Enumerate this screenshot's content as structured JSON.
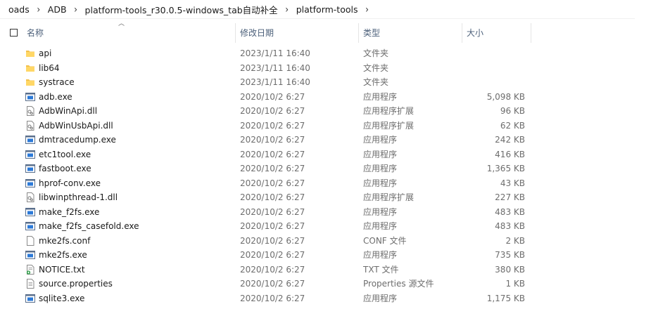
{
  "breadcrumb": [
    "oads",
    "ADB",
    "platform-tools_r30.0.5-windows_tab自动补全",
    "platform-tools"
  ],
  "columns": {
    "name": "名称",
    "date": "修改日期",
    "type": "类型",
    "size": "大小"
  },
  "files": [
    {
      "name": "api",
      "date": "2023/1/11 16:40",
      "type": "文件夹",
      "size": "",
      "icon": "folder-icon"
    },
    {
      "name": "lib64",
      "date": "2023/1/11 16:40",
      "type": "文件夹",
      "size": "",
      "icon": "folder-icon"
    },
    {
      "name": "systrace",
      "date": "2023/1/11 16:40",
      "type": "文件夹",
      "size": "",
      "icon": "folder-icon"
    },
    {
      "name": "adb.exe",
      "date": "2020/10/2 6:27",
      "type": "应用程序",
      "size": "5,098 KB",
      "icon": "exe-icon"
    },
    {
      "name": "AdbWinApi.dll",
      "date": "2020/10/2 6:27",
      "type": "应用程序扩展",
      "size": "96 KB",
      "icon": "dll-icon"
    },
    {
      "name": "AdbWinUsbApi.dll",
      "date": "2020/10/2 6:27",
      "type": "应用程序扩展",
      "size": "62 KB",
      "icon": "dll-icon"
    },
    {
      "name": "dmtracedump.exe",
      "date": "2020/10/2 6:27",
      "type": "应用程序",
      "size": "242 KB",
      "icon": "exe-icon"
    },
    {
      "name": "etc1tool.exe",
      "date": "2020/10/2 6:27",
      "type": "应用程序",
      "size": "416 KB",
      "icon": "exe-icon"
    },
    {
      "name": "fastboot.exe",
      "date": "2020/10/2 6:27",
      "type": "应用程序",
      "size": "1,365 KB",
      "icon": "exe-icon"
    },
    {
      "name": "hprof-conv.exe",
      "date": "2020/10/2 6:27",
      "type": "应用程序",
      "size": "43 KB",
      "icon": "exe-icon"
    },
    {
      "name": "libwinpthread-1.dll",
      "date": "2020/10/2 6:27",
      "type": "应用程序扩展",
      "size": "227 KB",
      "icon": "dll-icon"
    },
    {
      "name": "make_f2fs.exe",
      "date": "2020/10/2 6:27",
      "type": "应用程序",
      "size": "483 KB",
      "icon": "exe-icon"
    },
    {
      "name": "make_f2fs_casefold.exe",
      "date": "2020/10/2 6:27",
      "type": "应用程序",
      "size": "483 KB",
      "icon": "exe-icon"
    },
    {
      "name": "mke2fs.conf",
      "date": "2020/10/2 6:27",
      "type": "CONF 文件",
      "size": "2 KB",
      "icon": "file-icon"
    },
    {
      "name": "mke2fs.exe",
      "date": "2020/10/2 6:27",
      "type": "应用程序",
      "size": "735 KB",
      "icon": "exe-icon"
    },
    {
      "name": "NOTICE.txt",
      "date": "2020/10/2 6:27",
      "type": "TXT 文件",
      "size": "380 KB",
      "icon": "txt-icon"
    },
    {
      "name": "source.properties",
      "date": "2020/10/2 6:27",
      "type": "Properties 源文件",
      "size": "1 KB",
      "icon": "text-file-icon"
    },
    {
      "name": "sqlite3.exe",
      "date": "2020/10/2 6:27",
      "type": "应用程序",
      "size": "1,175 KB",
      "icon": "exe-icon"
    }
  ]
}
